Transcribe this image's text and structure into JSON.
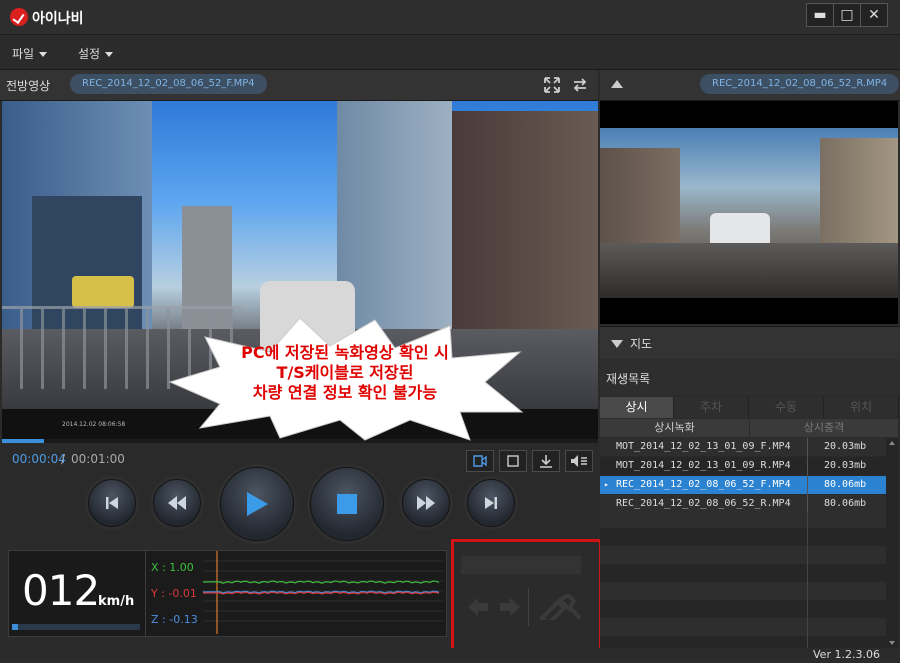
{
  "app": {
    "title": "아이나비",
    "window_buttons": {
      "minimize": "▬",
      "maximize": "□",
      "close": "✕"
    }
  },
  "menu": [
    "파일",
    "설정"
  ],
  "front": {
    "label": "전방영상",
    "file": "REC_2014_12_02_08_06_52_F.MP4",
    "overlay_text": "2014.12.02 08:06:58"
  },
  "rear": {
    "file": "REC_2014_12_02_08_06_52_R.MP4"
  },
  "callout": {
    "line1": "PC에 저장된 녹화영상 확인 시",
    "line2": "T/S케이블로 저장된",
    "line3": "차량 연결 정보 확인 불가능"
  },
  "time": {
    "current": "00:00:04",
    "separator": "/",
    "total": "00:01:00"
  },
  "playback_progress": 0.07,
  "speed": {
    "value": "012",
    "unit": "km/h"
  },
  "gsensor": {
    "x": "X : 1.00",
    "y": "Y : -0.01",
    "z": "Z : -0.13",
    "x_color": "#3fbf3f",
    "y_color": "#d63a3a",
    "z_color": "#4a8fe0"
  },
  "map_label": "지도",
  "playlist_label": "재생목록",
  "tabs": [
    "상시",
    "주차",
    "수동",
    "위치"
  ],
  "subtabs": [
    "상시녹화",
    "상시충격"
  ],
  "files": [
    {
      "name": "MOT_2014_12_02_13_01_09_F.MP4",
      "size": "20.03mb"
    },
    {
      "name": "MOT_2014_12_02_13_01_09_R.MP4",
      "size": "20.03mb"
    },
    {
      "name": "REC_2014_12_02_08_06_52_F.MP4",
      "size": "80.06mb",
      "selected": true
    },
    {
      "name": "REC_2014_12_02_08_06_52_R.MP4",
      "size": "80.06mb"
    }
  ],
  "version": "Ver 1.2.3.06",
  "colors": {
    "accent": "#3b8fd8",
    "highlight": "#d21414",
    "selected_row": "#2a82d0"
  },
  "icons": [
    "logo-icon",
    "expand-icon",
    "swap-icon",
    "collapse-icon",
    "chevron-down-icon",
    "capture-icon",
    "fit-icon",
    "download-icon",
    "volume-icon",
    "prev-icon",
    "rewind-icon",
    "play-icon",
    "stop-icon",
    "forward-icon",
    "next-icon",
    "arrows-icon",
    "tool-icon"
  ]
}
